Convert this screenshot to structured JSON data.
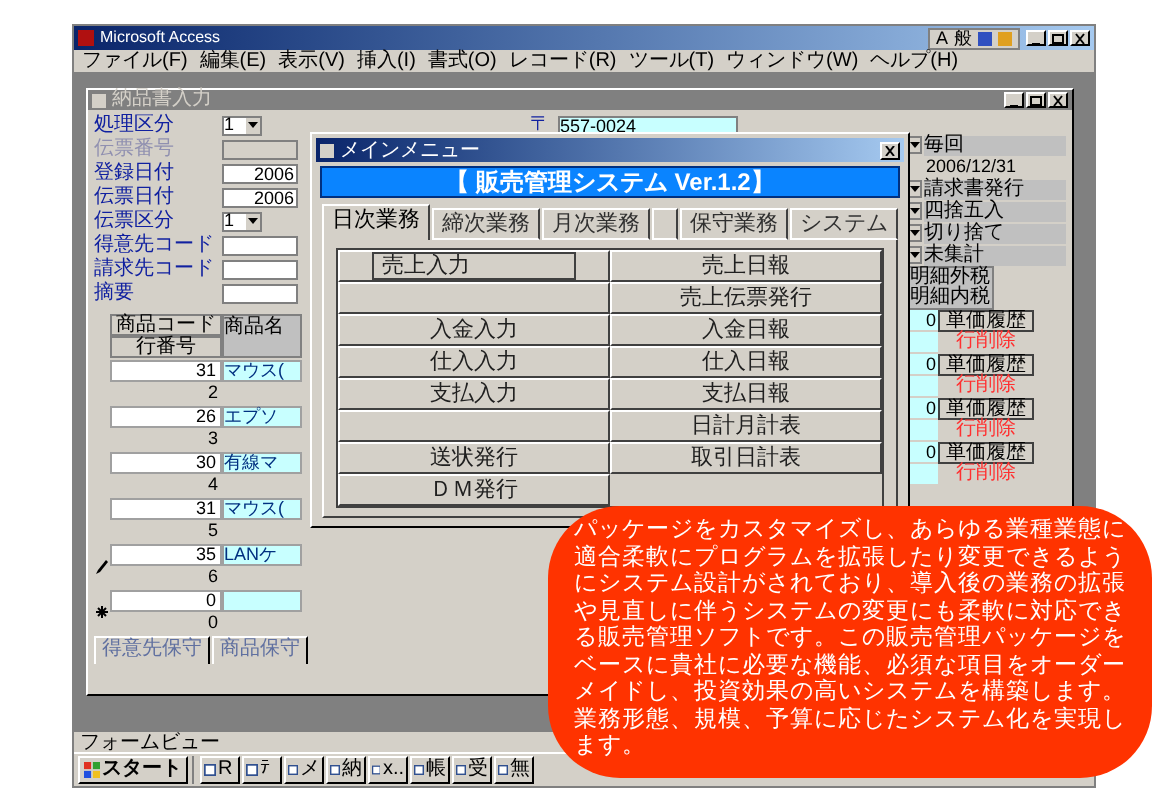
{
  "app": {
    "title": "Microsoft Access",
    "ime": [
      "A",
      "般"
    ],
    "menu": [
      "ファイル(F)",
      "編集(E)",
      "表示(V)",
      "挿入(I)",
      "書式(O)",
      "レコード(R)",
      "ツール(T)",
      "ウィンドウ(W)",
      "ヘルプ(H)"
    ],
    "status": "フォームビュー"
  },
  "form": {
    "title": "納品書入力",
    "fields": [
      {
        "label": "処理区分",
        "kind": "combo",
        "value": "1",
        "disabled": false
      },
      {
        "label": "伝票番号",
        "kind": "text",
        "disabled": true
      },
      {
        "label": "登録日付",
        "kind": "text",
        "value": "2006",
        "disabled": false
      },
      {
        "label": "伝票日付",
        "kind": "text",
        "value": "2006",
        "disabled": false
      },
      {
        "label": "伝票区分",
        "kind": "combo",
        "value": "1",
        "disabled": false
      },
      {
        "label": "得意先コード",
        "kind": "text",
        "disabled": false
      },
      {
        "label": "請求先コード",
        "kind": "text",
        "disabled": false
      },
      {
        "label": "摘要",
        "kind": "text",
        "disabled": false
      }
    ],
    "postal": {
      "label": "〒",
      "value": "557-0024"
    },
    "grid": {
      "columns": [
        "商品コード",
        "商品名"
      ],
      "subheader": "行番号",
      "rows": [
        {
          "code": "31",
          "name": "マウス(",
          "line": "2",
          "kind": "record"
        },
        {
          "code": "26",
          "name": "エプソ",
          "line": "3",
          "kind": "record"
        },
        {
          "code": "30",
          "name": "有線マ",
          "line": "4",
          "kind": "record"
        },
        {
          "code": "31",
          "name": "マウス(",
          "line": "5",
          "kind": "record"
        },
        {
          "code": "35",
          "name": "LANケ",
          "line": "6",
          "kind": "editing"
        },
        {
          "code": "0",
          "line": "0",
          "kind": "new"
        }
      ]
    },
    "side": {
      "first": "毎回",
      "date": "2006/12/31",
      "options": [
        "請求書発行",
        "四捨五入",
        "切り捨て",
        "未集計"
      ],
      "header": [
        "明細外税",
        "明細内税"
      ],
      "rows": [
        {
          "value": "0",
          "history": "単価履歴",
          "delete": "行削除"
        },
        {
          "value": "0",
          "history": "単価履歴",
          "delete": "行削除"
        },
        {
          "value": "0",
          "history": "単価履歴",
          "delete": "行削除"
        },
        {
          "value": "0",
          "history": "単価履歴",
          "delete": "行削除"
        }
      ]
    },
    "tabs": [
      {
        "label": "得意先保守"
      },
      {
        "label": "商品保守"
      }
    ]
  },
  "menu_window": {
    "title": "メインメニュー",
    "banner": "【 販売管理システム Ver.1.2】",
    "tabs": [
      {
        "label": "日次業務",
        "selected": true
      },
      {
        "label": "締次業務",
        "selected": false
      },
      {
        "label": "月次業務",
        "selected": false
      },
      {
        "selected": false
      },
      {
        "label": "保守業務",
        "selected": false
      },
      {
        "label": "システム",
        "selected": false
      }
    ],
    "left": [
      {
        "kind": "button",
        "label": "売上入力",
        "focused": true
      },
      {
        "kind": "blank"
      },
      {
        "kind": "button",
        "label": "入金入力",
        "focused": false
      },
      {
        "kind": "button",
        "label": "仕入入力",
        "focused": false
      },
      {
        "kind": "button",
        "label": "支払入力",
        "focused": false
      },
      {
        "kind": "blank"
      },
      {
        "kind": "button",
        "label": "送状発行",
        "focused": false
      },
      {
        "kind": "button",
        "label": "ＤＭ発行",
        "focused": false
      }
    ],
    "right": [
      {
        "kind": "button",
        "label": "売上日報",
        "focused": false
      },
      {
        "kind": "button",
        "label": "売上伝票発行",
        "focused": false
      },
      {
        "kind": "button",
        "label": "入金日報",
        "focused": false
      },
      {
        "kind": "button",
        "label": "仕入日報",
        "focused": false
      },
      {
        "kind": "button",
        "label": "支払日報",
        "focused": false
      },
      {
        "kind": "button",
        "label": "日計月計表",
        "focused": false
      },
      {
        "kind": "button",
        "label": "取引日計表",
        "focused": false
      }
    ]
  },
  "promo": {
    "text": "パッケージをカスタマイズし、あらゆる業種業態に適合柔軟にプログラムを拡張したり変更できるようにシステム設計がされており、導入後の業務の拡張や見直しに伴うシステムの変更にも柔軟に対応できる販売管理ソフトです。この販売管理パッケージをベースに貴社に必要な機能、必須な項目をオーダーメイドし、投資効果の高いシステムを構築します。業務形態、規模、予算に応じたシステム化を実現します。"
  },
  "taskbar": {
    "start": "スタート",
    "items": [
      "R",
      "ﾃ",
      "メ",
      "納",
      "x..",
      "帳",
      "受",
      "無"
    ]
  }
}
